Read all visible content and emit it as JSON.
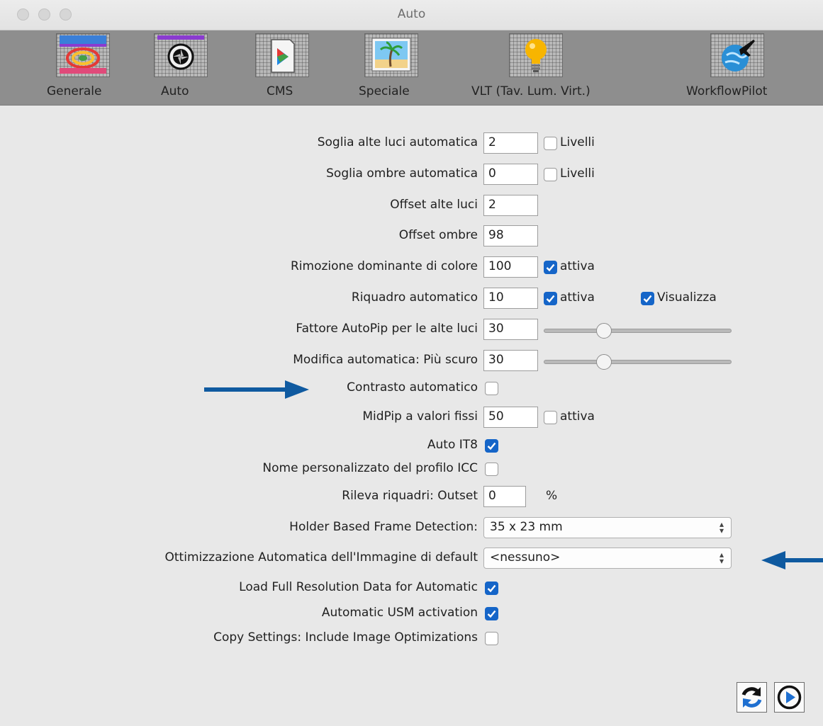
{
  "window": {
    "title": "Auto"
  },
  "toolbar": {
    "items": [
      {
        "label": "Generale",
        "icon": "color-wheel-icon"
      },
      {
        "label": "Auto",
        "icon": "aperture-icon"
      },
      {
        "label": "CMS",
        "icon": "color-profile-icon"
      },
      {
        "label": "Speciale",
        "icon": "palm-tree-picture-icon"
      },
      {
        "label": "VLT (Tav. Lum. Virt.)",
        "icon": "light-bulb-icon"
      },
      {
        "label": "WorkflowPilot",
        "icon": "globe-airplane-icon"
      }
    ]
  },
  "form": {
    "soglia_alte_luci": {
      "label": "Soglia alte luci automatica",
      "value": "2",
      "check_label": "Livelli",
      "checked": false
    },
    "soglia_ombre": {
      "label": "Soglia ombre automatica",
      "value": "0",
      "check_label": "Livelli",
      "checked": false
    },
    "offset_alte_luci": {
      "label": "Offset alte luci",
      "value": "2"
    },
    "offset_ombre": {
      "label": "Offset ombre",
      "value": "98"
    },
    "rimozione_dominante": {
      "label": "Rimozione dominante di colore",
      "value": "100",
      "check_label": "attiva",
      "checked": true
    },
    "riquadro_automatico": {
      "label": "Riquadro automatico",
      "value": "10",
      "check_label": "attiva",
      "checked": true,
      "check2_label": "Visualizza",
      "checked2": true
    },
    "fattore_autopip": {
      "label": "Fattore AutoPip per le alte luci",
      "value": "30",
      "slider_fraction": 0.32
    },
    "modifica_automatica": {
      "label": "Modifica automatica: Più scuro",
      "value": "30",
      "slider_fraction": 0.32
    },
    "contrasto_automatico": {
      "label": "Contrasto automatico",
      "checked": false
    },
    "midpip": {
      "label": "MidPip a valori fissi",
      "value": "50",
      "check_label": "attiva",
      "checked": false
    },
    "auto_it8": {
      "label": "Auto IT8",
      "checked": true
    },
    "nome_profilo_icc": {
      "label": "Nome personalizzato del profilo ICC",
      "checked": false
    },
    "rileva_riquadri": {
      "label": "Rileva riquadri: Outset",
      "value": "0",
      "unit": "%"
    },
    "holder_frame_detection": {
      "label": "Holder Based Frame Detection:",
      "selected": "35 x 23 mm"
    },
    "ottimizzazione_default": {
      "label": "Ottimizzazione Automatica dell'Immagine di default",
      "selected": "<nessuno>"
    },
    "load_full_resolution": {
      "label": "Load Full Resolution Data for Automatic",
      "checked": true
    },
    "automatic_usm": {
      "label": "Automatic USM activation",
      "checked": true
    },
    "copy_settings": {
      "label": "Copy Settings: Include Image Optimizations",
      "checked": false
    }
  },
  "bottom_buttons": {
    "reset_icon": "refresh-icon",
    "play_icon": "play-circle-icon"
  },
  "colors": {
    "accent": "#1565c8",
    "annotation_arrow": "#0f5aa0",
    "toolbar_bg": "#8e8e8e"
  }
}
